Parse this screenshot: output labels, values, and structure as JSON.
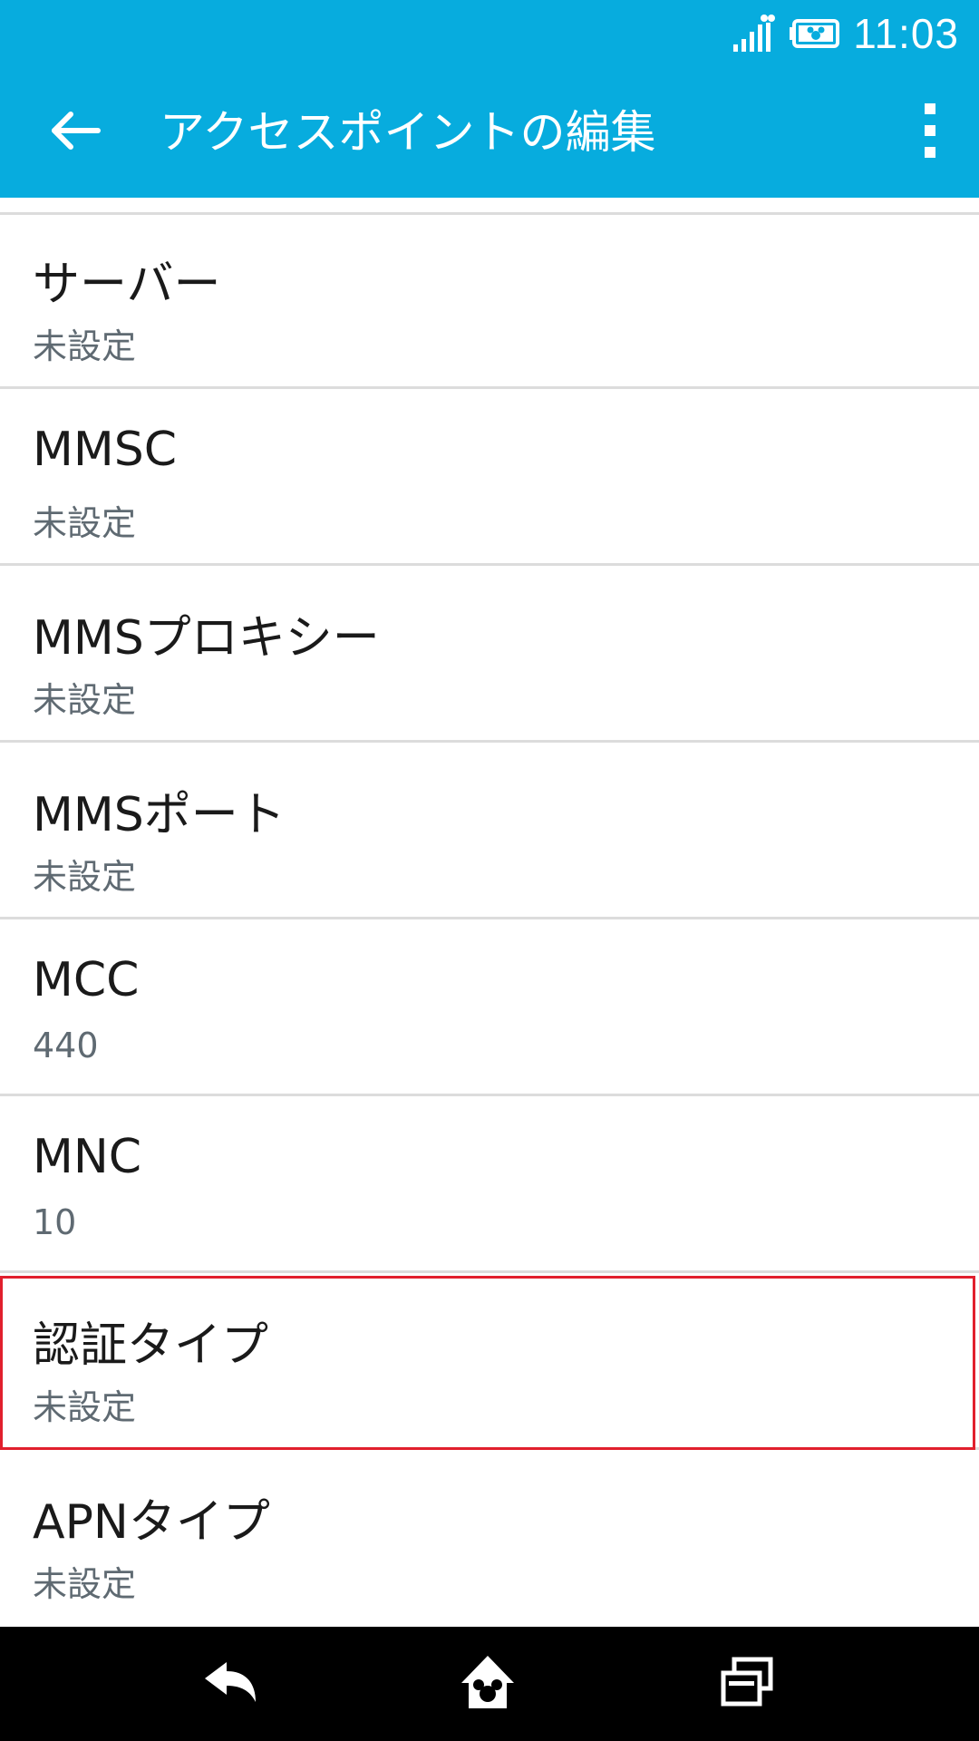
{
  "status_bar": {
    "time": "11:03",
    "signal_icon": "signal-icon",
    "battery_icon": "battery-icon"
  },
  "app_bar": {
    "title": "アクセスポイントの編集",
    "back_icon": "arrow-back-icon",
    "menu_icon": "more-vert-icon"
  },
  "settings": [
    {
      "title": "サーバー",
      "summary": "未設定"
    },
    {
      "title": "MMSC",
      "summary": "未設定"
    },
    {
      "title": "MMSプロキシー",
      "summary": "未設定"
    },
    {
      "title": "MMSポート",
      "summary": "未設定"
    },
    {
      "title": "MCC",
      "summary": "440"
    },
    {
      "title": "MNC",
      "summary": "10"
    },
    {
      "title": "認証タイプ",
      "summary": "未設定"
    },
    {
      "title": "APNタイプ",
      "summary": "未設定"
    }
  ],
  "nav_bar": {
    "back_icon": "nav-back-icon",
    "home_icon": "nav-home-icon",
    "recents_icon": "nav-recents-icon"
  },
  "colors": {
    "app_bar": "#07acde",
    "highlight_border": "#e11f2d",
    "nav_bar": "#000000"
  }
}
